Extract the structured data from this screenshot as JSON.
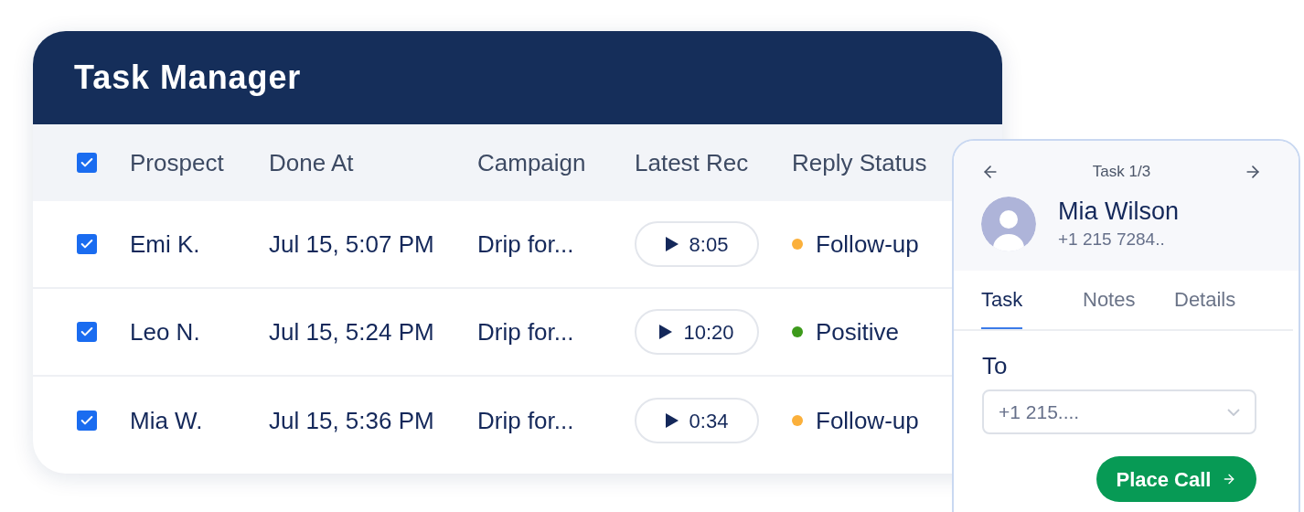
{
  "task_manager": {
    "title": "Task Manager",
    "header": {
      "checked": true,
      "columns": [
        "Prospect",
        "Done At",
        "Campaign",
        "Latest Rec",
        "Reply Status"
      ]
    },
    "rows": [
      {
        "checked": true,
        "prospect": "Emi K.",
        "done_at": "Jul 15, 5:07 PM",
        "campaign": "Drip for...",
        "recording": "8:05",
        "status": "Follow-up",
        "color": "#fbb03b"
      },
      {
        "checked": true,
        "prospect": "Leo N.",
        "done_at": "Jul 15, 5:24 PM",
        "campaign": "Drip for...",
        "recording": "10:20",
        "status": "Positive",
        "color": "#3d9a1b"
      },
      {
        "checked": true,
        "prospect": "Mia W.",
        "done_at": "Jul 15, 5:36 PM",
        "campaign": "Drip for...",
        "recording": "0:34",
        "status": "Follow-up",
        "color": "#fbb03b"
      }
    ]
  },
  "task_panel": {
    "counter": "Task 1/3",
    "name": "Mia Wilson",
    "phone": "+1 215 7284..",
    "tabs": [
      {
        "label": "Task",
        "selected": true
      },
      {
        "label": "Notes",
        "selected": false
      },
      {
        "label": "Details",
        "selected": false
      }
    ],
    "to_label": "To",
    "to_value": "+1 215....",
    "button": "Place Call"
  }
}
